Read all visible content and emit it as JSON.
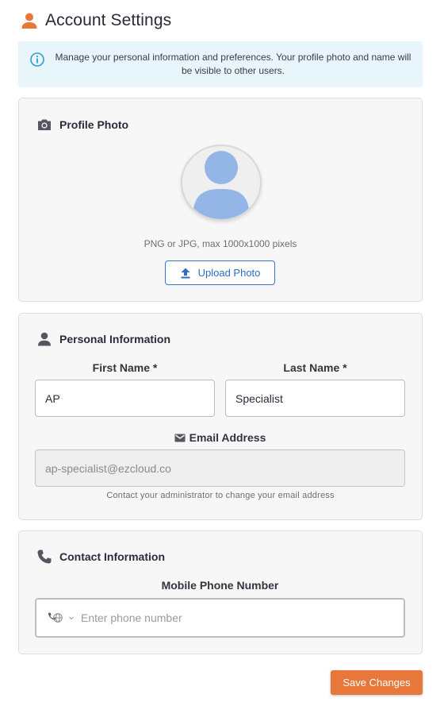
{
  "header": {
    "title": "Account Settings",
    "icon": "person-icon",
    "accent": "#e8773b"
  },
  "info": {
    "icon": "info-icon",
    "text": "Manage your personal information and preferences. Your profile photo and name will be visible to other users."
  },
  "profile_photo": {
    "title": "Profile Photo",
    "icon": "camera-icon",
    "hint": "PNG or JPG, max 1000x1000 pixels",
    "upload_label": "Upload Photo"
  },
  "personal": {
    "title": "Personal Information",
    "icon": "person-icon",
    "first_name_label": "First Name *",
    "first_name_value": "AP",
    "last_name_label": "Last Name *",
    "last_name_value": "Specialist",
    "email_label": "Email Address",
    "email_value": "ap-specialist@ezcloud.co",
    "email_note": "Contact your administrator to change your email address"
  },
  "contact": {
    "title": "Contact Information",
    "icon": "phone-icon",
    "mobile_label": "Mobile Phone Number",
    "mobile_placeholder": "Enter phone number"
  },
  "footer": {
    "save_label": "Save Changes"
  }
}
